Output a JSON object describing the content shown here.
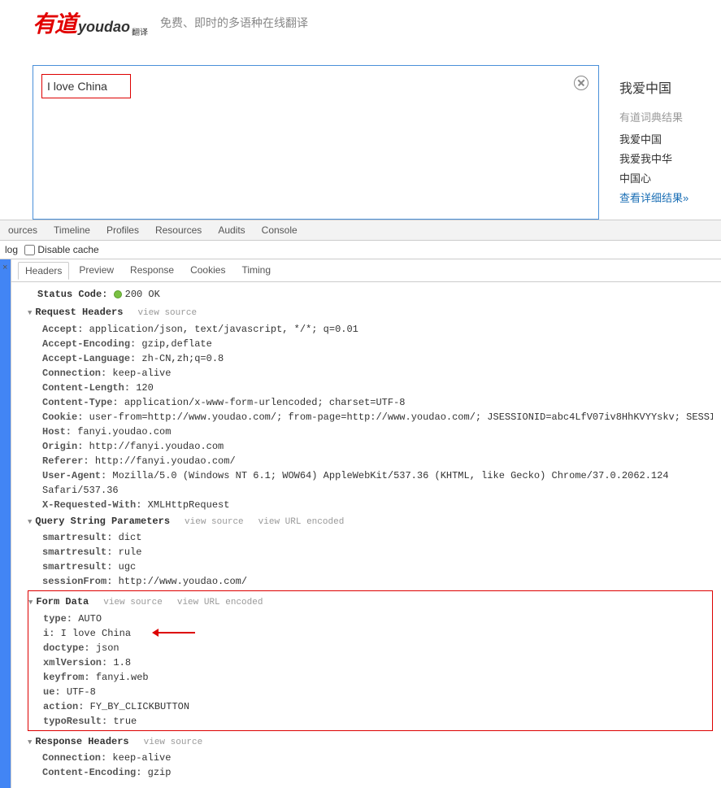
{
  "header": {
    "logo_cn": "有道",
    "logo_en": "youdao",
    "logo_sub": "翻译",
    "tagline": "免费、即时的多语种在线翻译"
  },
  "translate": {
    "input_text": "I love China",
    "result_title": "我爱中国",
    "dict_label": "有道词典结果",
    "results": [
      "我爱中国",
      "我爱我中华",
      "中国心"
    ],
    "detail_link": "查看详细结果"
  },
  "devtools": {
    "main_tabs": [
      "ources",
      "Timeline",
      "Profiles",
      "Resources",
      "Audits",
      "Console"
    ],
    "toolbar_log": "log",
    "toolbar_disable_cache": "Disable cache",
    "close_x": "×",
    "sub_tabs": [
      "Headers",
      "Preview",
      "Response",
      "Cookies",
      "Timing"
    ],
    "status_code_label": "Status Code:",
    "status_code_value": "200 OK",
    "view_source": "view source",
    "view_url_encoded": "view URL encoded",
    "sections": {
      "request_headers": {
        "title": "Request Headers",
        "items": [
          {
            "k": "Accept:",
            "v": "application/json, text/javascript, */*; q=0.01"
          },
          {
            "k": "Accept-Encoding:",
            "v": "gzip,deflate"
          },
          {
            "k": "Accept-Language:",
            "v": "zh-CN,zh;q=0.8"
          },
          {
            "k": "Connection:",
            "v": "keep-alive"
          },
          {
            "k": "Content-Length:",
            "v": "120"
          },
          {
            "k": "Content-Type:",
            "v": "application/x-www-form-urlencoded; charset=UTF-8"
          },
          {
            "k": "Cookie:",
            "v": "user-from=http://www.youdao.com/; from-page=http://www.youdao.com/; JSESSIONID=abc4LfV07iv8HhKVYYskv; SESSION_FROM_COOKIE=FOX_SEARCH_USER_ID_NCOO=1151521872.9637809; YOUDAO_EAD_UUID=19414de7-6da7-4b6a-88b4-950fac9feaa0; ___rl__test__cookies=14541651"
          },
          {
            "k": "Host:",
            "v": "fanyi.youdao.com"
          },
          {
            "k": "Origin:",
            "v": "http://fanyi.youdao.com"
          },
          {
            "k": "Referer:",
            "v": "http://fanyi.youdao.com/"
          },
          {
            "k": "User-Agent:",
            "v": "Mozilla/5.0 (Windows NT 6.1; WOW64) AppleWebKit/537.36 (KHTML, like Gecko) Chrome/37.0.2062.124 Safari/537.36"
          },
          {
            "k": "X-Requested-With:",
            "v": "XMLHttpRequest"
          }
        ]
      },
      "query_string": {
        "title": "Query String Parameters",
        "items": [
          {
            "k": "smartresult:",
            "v": "dict"
          },
          {
            "k": "smartresult:",
            "v": "rule"
          },
          {
            "k": "smartresult:",
            "v": "ugc"
          },
          {
            "k": "sessionFrom:",
            "v": "http://www.youdao.com/"
          }
        ]
      },
      "form_data": {
        "title": "Form Data",
        "items": [
          {
            "k": "type:",
            "v": "AUTO"
          },
          {
            "k": "i:",
            "v": "I love China"
          },
          {
            "k": "doctype:",
            "v": "json"
          },
          {
            "k": "xmlVersion:",
            "v": "1.8"
          },
          {
            "k": "keyfrom:",
            "v": "fanyi.web"
          },
          {
            "k": "ue:",
            "v": "UTF-8"
          },
          {
            "k": "action:",
            "v": "FY_BY_CLICKBUTTON"
          },
          {
            "k": "typoResult:",
            "v": "true"
          }
        ]
      },
      "response_headers": {
        "title": "Response Headers",
        "items": [
          {
            "k": "Connection:",
            "v": "keep-alive"
          },
          {
            "k": "Content-Encoding:",
            "v": "gzip"
          }
        ]
      }
    }
  }
}
